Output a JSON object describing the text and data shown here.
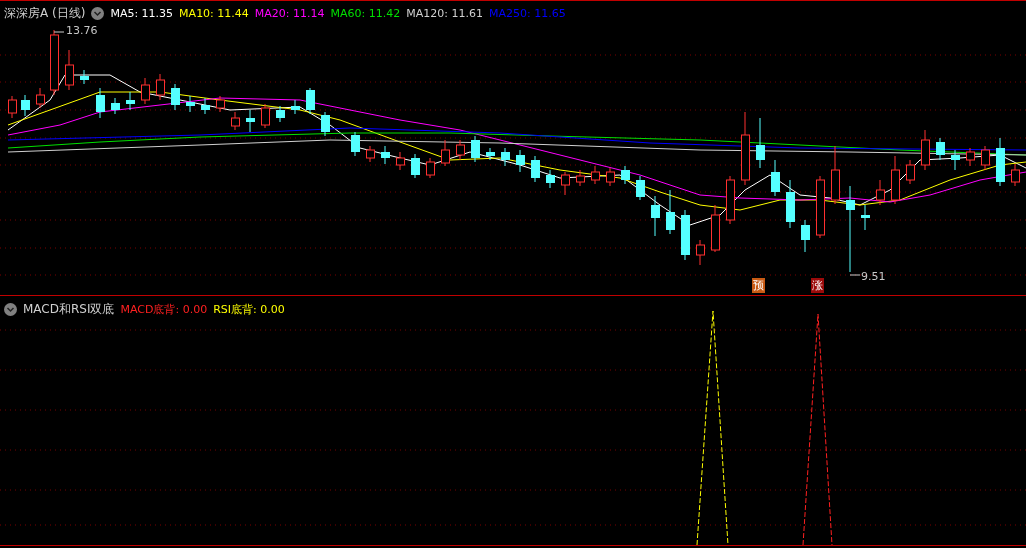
{
  "main_panel": {
    "title": "深深房A (日线)",
    "indicators": [
      {
        "label": "MA5: 11.35",
        "color": "#ffffff"
      },
      {
        "label": "MA10: 11.44",
        "color": "#ffff00"
      },
      {
        "label": "MA20: 11.14",
        "color": "#ff00ff"
      },
      {
        "label": "MA60: 11.42",
        "color": "#00e000"
      },
      {
        "label": "MA120: 11.61",
        "color": "#d0d0d0"
      },
      {
        "label": "MA250: 11.65",
        "color": "#0000ff"
      }
    ],
    "high_label": "13.76",
    "low_label": "9.51",
    "signals": [
      {
        "text": "预",
        "color": "#c85a14"
      },
      {
        "text": "涨",
        "color": "#9b0a0a"
      }
    ]
  },
  "sub_panel": {
    "title": "MACD和RSI双底",
    "indicators": [
      {
        "label": "MACD底背: 0.00",
        "color": "#ff2020"
      },
      {
        "label": "RSI底背: 0.00",
        "color": "#ffff00"
      }
    ]
  }
}
